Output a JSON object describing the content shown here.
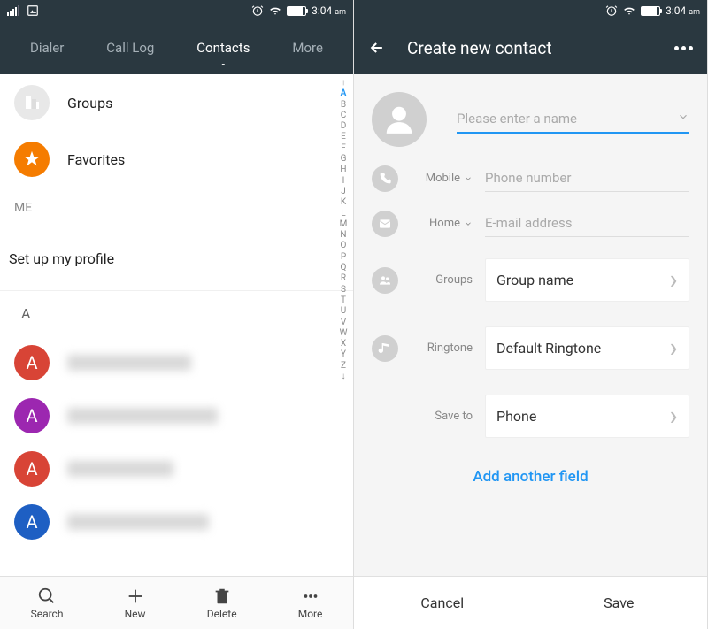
{
  "status": {
    "time": "3:04",
    "ampm": "am"
  },
  "left": {
    "tabs": {
      "dialer": "Dialer",
      "callLog": "Call Log",
      "contacts": "Contacts",
      "more": "More"
    },
    "groups": "Groups",
    "favorites": "Favorites",
    "meLabel": "ME",
    "setupProfile": "Set up my profile",
    "letterA": "A",
    "contactInitials": [
      "A",
      "A",
      "A",
      "A"
    ],
    "alphaIndex": [
      "↑",
      "A",
      "B",
      "C",
      "D",
      "E",
      "F",
      "G",
      "H",
      "I",
      "J",
      "K",
      "L",
      "M",
      "N",
      "O",
      "P",
      "Q",
      "R",
      "S",
      "T",
      "U",
      "V",
      "W",
      "X",
      "Y",
      "Z",
      "↓"
    ],
    "bottom": {
      "search": "Search",
      "new": "New",
      "delete": "Delete",
      "more": "More"
    }
  },
  "right": {
    "title": "Create new contact",
    "nameField": {
      "placeholder": "Please enter a name"
    },
    "phone": {
      "type": "Mobile",
      "placeholder": "Phone number"
    },
    "email": {
      "type": "Home",
      "placeholder": "E-mail address"
    },
    "groups": {
      "label": "Groups",
      "value": "Group name"
    },
    "ringtone": {
      "label": "Ringtone",
      "value": "Default Ringtone"
    },
    "saveTo": {
      "label": "Save to",
      "value": "Phone"
    },
    "addAnother": "Add another field",
    "cancel": "Cancel",
    "save": "Save"
  }
}
